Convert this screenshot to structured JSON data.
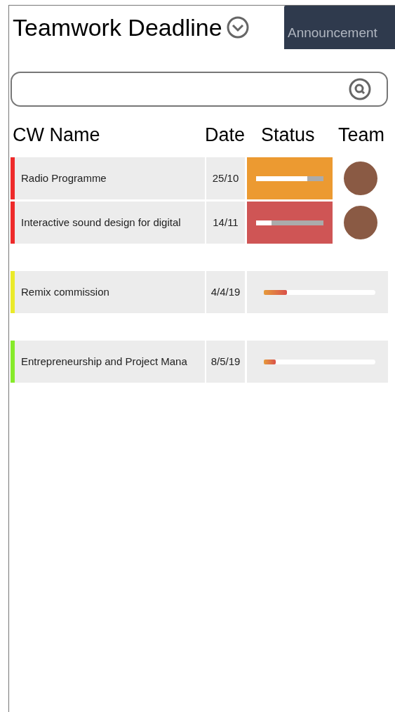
{
  "tabs": [
    {
      "label": "Teamwork Deadline",
      "selected": true
    },
    {
      "label": "Announcement",
      "selected": false
    }
  ],
  "table": {
    "columns": [
      "CW Name",
      "Date",
      "Status",
      "Team"
    ],
    "rows": [
      {
        "kind": "team",
        "name": "Radio Programme",
        "date": "25/10",
        "color": "#ee2a2a",
        "status": {
          "color": "#ec9a31",
          "level": 0.76
        }
      },
      {
        "kind": "team",
        "name": "Interactive sound design for digital",
        "date": "14/11",
        "color": "#ee2a2a",
        "status": {
          "color": "#cf5555",
          "level": 0.23
        }
      },
      {
        "kind": "solo",
        "name": "Remix commission",
        "date": "4/4/19",
        "color": "#eaea2a",
        "status": {
          "level": 0.21
        }
      },
      {
        "kind": "solo",
        "name": "Entrepreneurship and Project Mana",
        "date": "8/5/19",
        "color": "#86ea2a",
        "status": {
          "level": 0.11
        }
      }
    ]
  }
}
